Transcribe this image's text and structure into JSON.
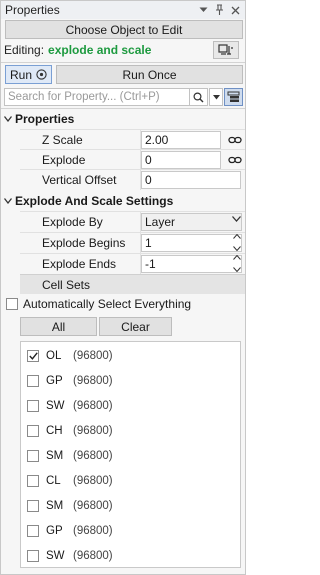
{
  "titlebar": {
    "title": "Properties",
    "icons": [
      "dropdown-arrow-icon",
      "pin-icon",
      "close-icon"
    ]
  },
  "choose_button": "Choose Object to Edit",
  "editing": {
    "label": "Editing:",
    "target": "explode and scale",
    "target_color": "#1d9a3f"
  },
  "run_button": "Run",
  "run_once_button": "Run Once",
  "search": {
    "placeholder": "Search for Property... (Ctrl+P)"
  },
  "properties_section": {
    "title": "Properties",
    "rows": [
      {
        "name": "Z Scale",
        "value": "2.00"
      },
      {
        "name": "Explode",
        "value": "0"
      },
      {
        "name": "Vertical Offset",
        "value": "0"
      }
    ]
  },
  "explode_section": {
    "title": "Explode And Scale Settings",
    "rows": [
      {
        "name": "Explode By",
        "value": "Layer"
      },
      {
        "name": "Explode Begins",
        "value": "1"
      },
      {
        "name": "Explode Ends",
        "value": "-1"
      }
    ]
  },
  "cell_sets_label": "Cell Sets",
  "auto_select_label": "Automatically Select Everything",
  "auto_select_checked": false,
  "all_button": "All",
  "clear_button": "Clear",
  "cell_sets": [
    {
      "name": "OL",
      "count": "(96800)",
      "checked": true
    },
    {
      "name": "GP",
      "count": "(96800)",
      "checked": false
    },
    {
      "name": "SW",
      "count": "(96800)",
      "checked": false
    },
    {
      "name": "CH",
      "count": "(96800)",
      "checked": false
    },
    {
      "name": "SM",
      "count": "(96800)",
      "checked": false
    },
    {
      "name": "CL",
      "count": "(96800)",
      "checked": false
    },
    {
      "name": "SM",
      "count": "(96800)",
      "checked": false
    },
    {
      "name": "GP",
      "count": "(96800)",
      "checked": false
    },
    {
      "name": "SW",
      "count": "(96800)",
      "checked": false
    }
  ],
  "colors": {
    "accent_border": "#7a9fd4",
    "accent_fill": "#dfe9f7"
  }
}
